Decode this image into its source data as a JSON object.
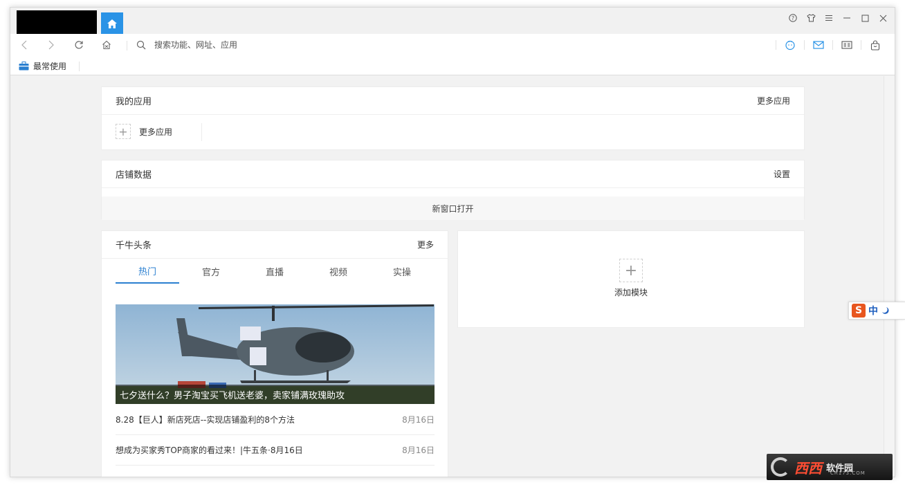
{
  "navbar": {
    "search_placeholder": "搜索功能、网址、应用"
  },
  "bookmarks": {
    "frequent_label": "最常使用"
  },
  "my_apps": {
    "title": "我的应用",
    "more_link": "更多应用",
    "more_item_label": "更多应用"
  },
  "shop_data": {
    "title": "店铺数据",
    "settings_link": "设置",
    "open_new_window": "新窗口打开"
  },
  "headlines": {
    "title": "千牛头条",
    "more_link": "更多",
    "tabs": [
      {
        "label": "热门"
      },
      {
        "label": "官方"
      },
      {
        "label": "直播"
      },
      {
        "label": "视频"
      },
      {
        "label": "实操"
      }
    ],
    "hero_caption": "七夕送什么？男子淘宝买飞机送老婆，卖家铺满玫瑰助攻",
    "news": [
      {
        "title": "8.28【巨人】新店死店--实现店铺盈利的8个方法",
        "date": "8月16日"
      },
      {
        "title": "想成为买家秀TOP商家的看过来！|牛五条·8月16日",
        "date": "8月16日"
      }
    ]
  },
  "add_module": {
    "label": "添加模块"
  },
  "ime": {
    "lang": "中"
  },
  "watermark": {
    "brand": "西西",
    "subtitle": "软件园",
    "small": "CR173.COM"
  },
  "colors": {
    "accent": "#2a93e6",
    "tab_active": "#2a7fd0"
  }
}
